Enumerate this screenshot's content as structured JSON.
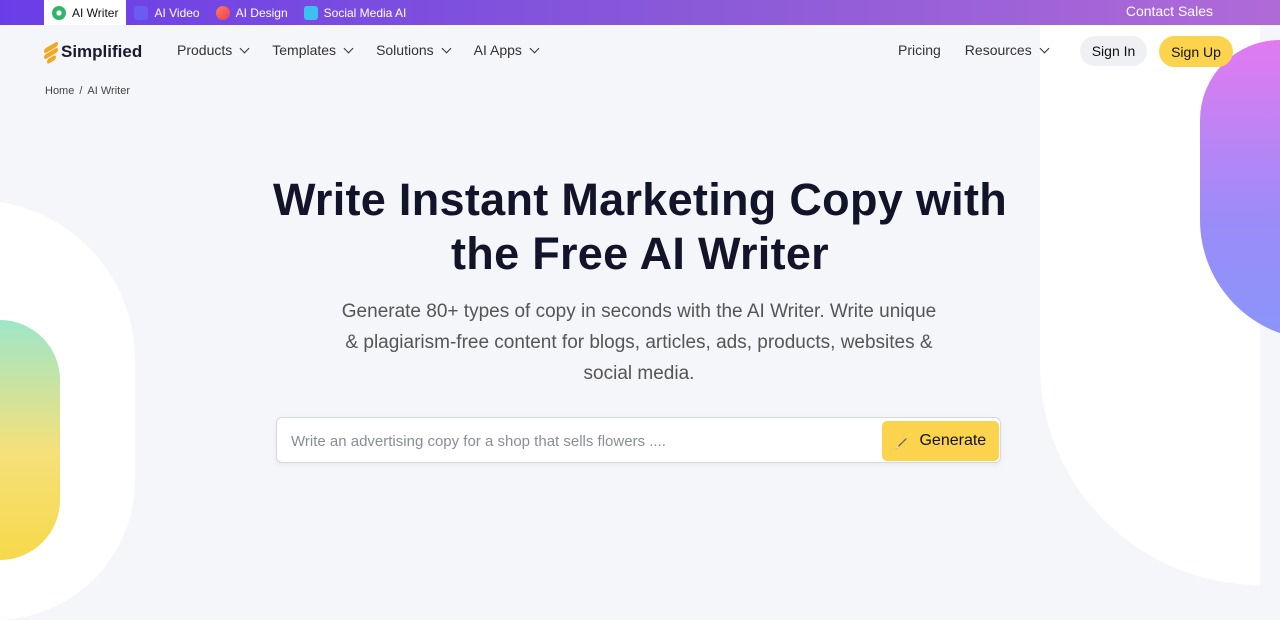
{
  "topbar": {
    "tabs": [
      {
        "label": "AI Writer",
        "icon": "ai-writer-icon",
        "active": true
      },
      {
        "label": "AI Video",
        "icon": "video-icon",
        "active": false
      },
      {
        "label": "AI Design",
        "icon": "design-icon",
        "active": false
      },
      {
        "label": "Social Media AI",
        "icon": "social-icon",
        "active": false
      }
    ],
    "contact_label": "Contact Sales"
  },
  "nav": {
    "logo_text": "Simplified",
    "links": [
      "Products",
      "Templates",
      "Solutions",
      "AI Apps"
    ],
    "pricing_label": "Pricing",
    "resources_label": "Resources",
    "signin_label": "Sign In",
    "signup_label": "Sign Up"
  },
  "breadcrumb": {
    "home": "Home",
    "sep": "/",
    "current": "AI Writer"
  },
  "hero": {
    "title_line1": "Write Instant Marketing Copy with",
    "title_line2": "the Free AI Writer",
    "subtitle": "Generate 80+ types of copy in seconds with the AI Writer. Write unique & plagiarism-free content for blogs, articles, ads, products, websites & social media.",
    "input_placeholder": "Write an advertising copy for a shop that sells flowers ....",
    "generate_label": "Generate"
  },
  "colors": {
    "accent_yellow": "#fcd34d",
    "topbar_purple": "#6a3de8",
    "title": "#13132a"
  }
}
